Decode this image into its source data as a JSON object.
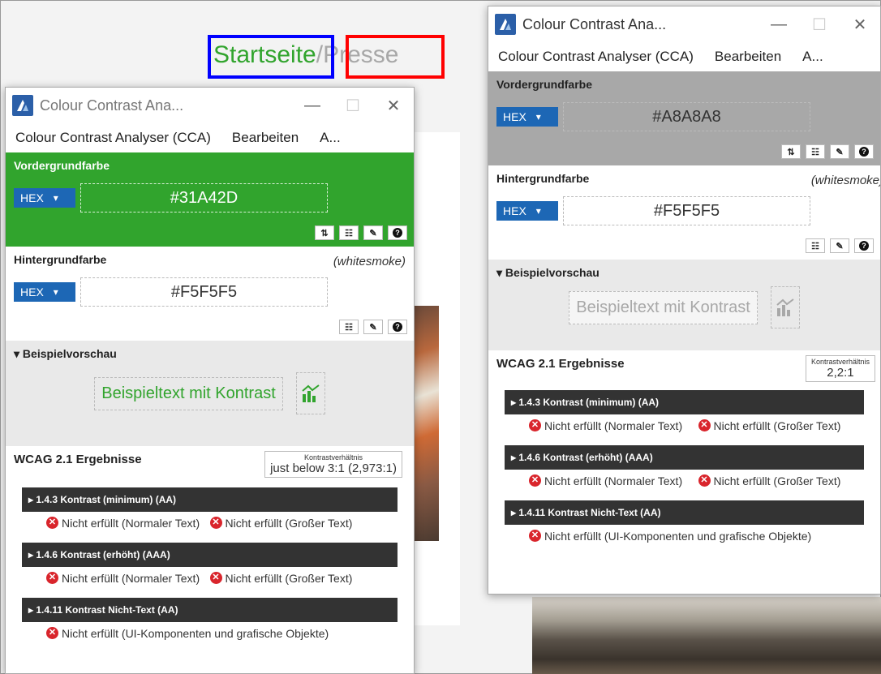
{
  "background_page": {
    "breadcrumb_start": "Startseite",
    "breadcrumb_separator": "/",
    "breadcrumb_presse": "Presse",
    "colors": {
      "start": "#31A42D",
      "presse": "#A8A8A8",
      "highlight_blue": "#0000ff",
      "highlight_red": "#ff0000"
    }
  },
  "cca_left": {
    "title": "Colour Contrast Ana...",
    "window_buttons": {
      "minimize": "—",
      "maximize": "☐",
      "close": "✕"
    },
    "menu": [
      "Colour Contrast Analyser (CCA)",
      "Bearbeiten",
      "A..."
    ],
    "foreground": {
      "label": "Vordergrundfarbe",
      "format": "HEX",
      "value": "#31A42D",
      "color": "#31A42D"
    },
    "background": {
      "label": "Hintergrundfarbe",
      "name": "(whitesmoke)",
      "format": "HEX",
      "value": "#F5F5F5"
    },
    "preview": {
      "label": "▾ Beispielvorschau",
      "sample_text": "Beispieltext mit Kontrast"
    },
    "results": {
      "title": "WCAG 2.1 Ergebnisse",
      "ratio_label": "Kontrastverhältnis",
      "ratio_value": "just below 3:1 (2,973:1)",
      "criteria": [
        {
          "header": "▸ 1.4.3 Kontrast (minimum) (AA)",
          "results": [
            "Nicht erfüllt (Normaler Text)",
            "Nicht erfüllt (Großer Text)"
          ]
        },
        {
          "header": "▸ 1.4.6 Kontrast (erhöht) (AAA)",
          "results": [
            "Nicht erfüllt (Normaler Text)",
            "Nicht erfüllt (Großer Text)"
          ]
        },
        {
          "header": "▸ 1.4.11 Kontrast Nicht-Text (AA)",
          "results": [
            "Nicht erfüllt (UI-Komponenten und grafische Objekte)"
          ]
        }
      ]
    }
  },
  "cca_right": {
    "title": "Colour Contrast Ana...",
    "window_buttons": {
      "minimize": "—",
      "maximize": "☐",
      "close": "✕"
    },
    "menu": [
      "Colour Contrast Analyser (CCA)",
      "Bearbeiten",
      "A..."
    ],
    "foreground": {
      "label": "Vordergrundfarbe",
      "format": "HEX",
      "value": "#A8A8A8",
      "color": "#A8A8A8"
    },
    "background": {
      "label": "Hintergrundfarbe",
      "name": "(whitesmoke)",
      "format": "HEX",
      "value": "#F5F5F5"
    },
    "preview": {
      "label": "▾ Beispielvorschau",
      "sample_text": "Beispieltext mit Kontrast"
    },
    "results": {
      "title": "WCAG 2.1 Ergebnisse",
      "ratio_label": "Kontrastverhältnis",
      "ratio_value": "2,2:1",
      "criteria": [
        {
          "header": "▸ 1.4.3 Kontrast (minimum) (AA)",
          "results": [
            "Nicht erfüllt (Normaler Text)",
            "Nicht erfüllt (Großer Text)"
          ]
        },
        {
          "header": "▸ 1.4.6 Kontrast (erhöht) (AAA)",
          "results": [
            "Nicht erfüllt (Normaler Text)",
            "Nicht erfüllt (Großer Text)"
          ]
        },
        {
          "header": "▸ 1.4.11 Kontrast Nicht-Text (AA)",
          "results": [
            "Nicht erfüllt (UI-Komponenten und grafische Objekte)"
          ]
        }
      ]
    }
  },
  "tool_icons": [
    "swap-icon",
    "sliders-icon",
    "eyedropper-icon",
    "help-icon"
  ]
}
